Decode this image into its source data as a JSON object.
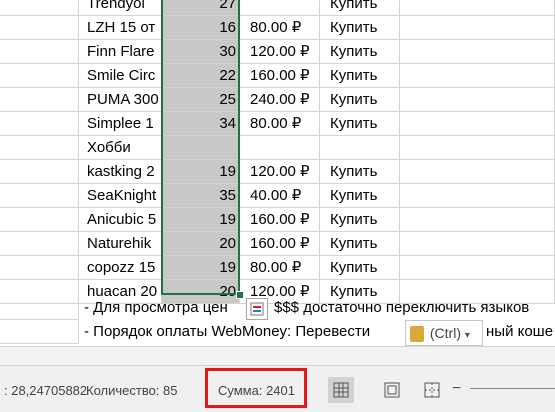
{
  "rows": [
    {
      "name": "Trendyol",
      "qty": "27",
      "price": "",
      "action": "Купить"
    },
    {
      "name": "LZH 15 от",
      "qty": "16",
      "price": "80.00 ₽",
      "action": "Купить"
    },
    {
      "name": "Finn Flare",
      "qty": "30",
      "price": "120.00 ₽",
      "action": "Купить"
    },
    {
      "name": "Smile Circ",
      "qty": "22",
      "price": "160.00 ₽",
      "action": "Купить"
    },
    {
      "name": "PUMA 300",
      "qty": "25",
      "price": "240.00 ₽",
      "action": "Купить"
    },
    {
      "name": "Simplee 1",
      "qty": "34",
      "price": "80.00 ₽",
      "action": "Купить"
    },
    {
      "name": "Хобби",
      "qty": "",
      "price": "",
      "action": ""
    },
    {
      "name": "kastking 2",
      "qty": "19",
      "price": "120.00 ₽",
      "action": "Купить"
    },
    {
      "name": "SeaKnight",
      "qty": "35",
      "price": "40.00 ₽",
      "action": "Купить"
    },
    {
      "name": "Anicubic 5",
      "qty": "19",
      "price": "160.00 ₽",
      "action": "Купить"
    },
    {
      "name": "Naturehik",
      "qty": "20",
      "price": "160.00 ₽",
      "action": "Купить"
    },
    {
      "name": "copozz 15",
      "qty": "19",
      "price": "80.00 ₽",
      "action": "Купить"
    },
    {
      "name": "huacan 20",
      "qty": "20",
      "price": "120.00 ₽",
      "action": "Купить"
    }
  ],
  "note1": "- Для просмотра цен",
  "note1_tail": "$$$ достаточно переключить языков",
  "note2": "- Порядок оплаты WebMoney: Перевести",
  "note2_tail": "ный коше",
  "paste_options_label": "(Ctrl)",
  "status": {
    "average": ": 28,24705882",
    "count": "Количество: 85",
    "sum": "Сумма: 2401"
  },
  "accent_color": "#217346",
  "highlight_color": "#e2171c"
}
